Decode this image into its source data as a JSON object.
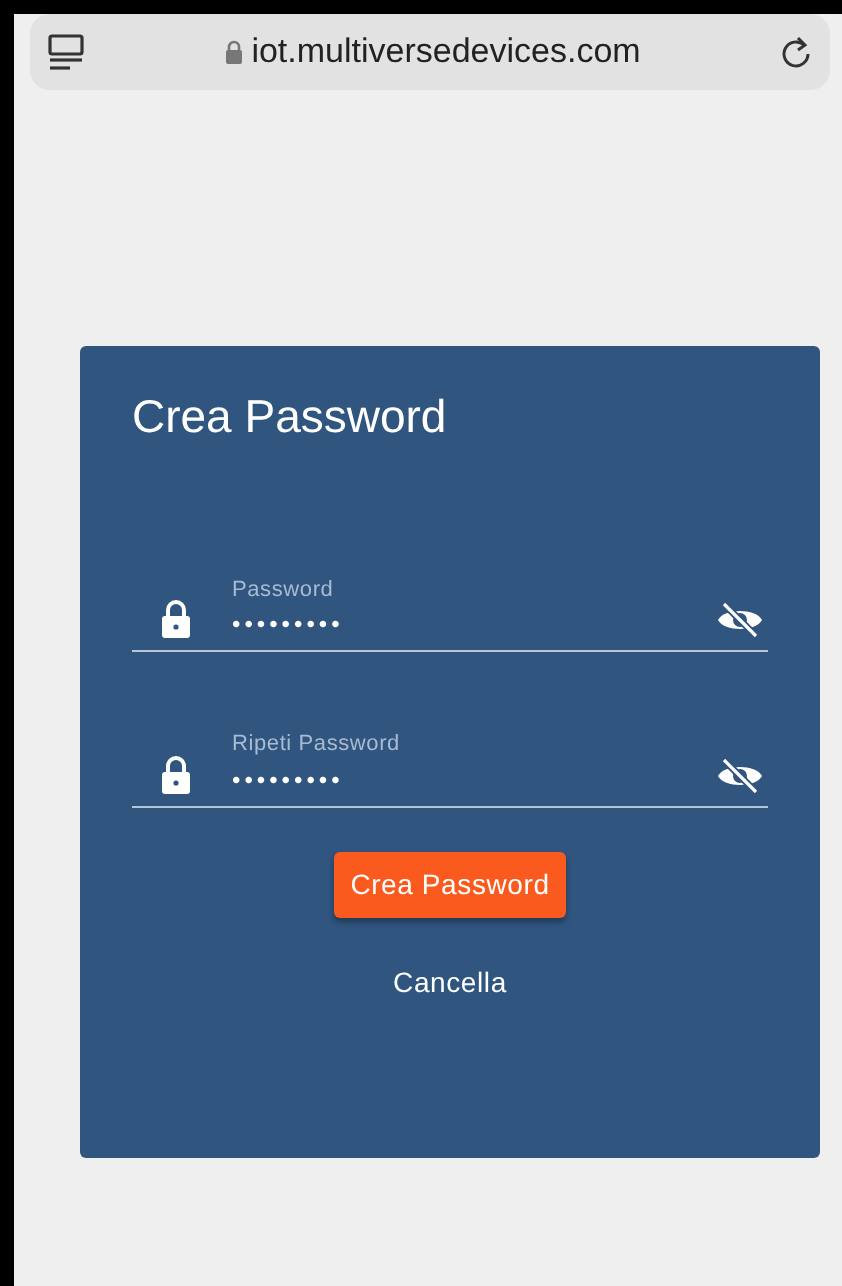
{
  "browser": {
    "url": "iot.multiversedevices.com"
  },
  "card": {
    "title": "Crea Password",
    "fields": [
      {
        "label": "Password",
        "value": "•••••••••"
      },
      {
        "label": "Ripeti Password",
        "value": "•••••••••"
      }
    ],
    "primary_button": "Crea Password",
    "cancel_button": "Cancella"
  }
}
